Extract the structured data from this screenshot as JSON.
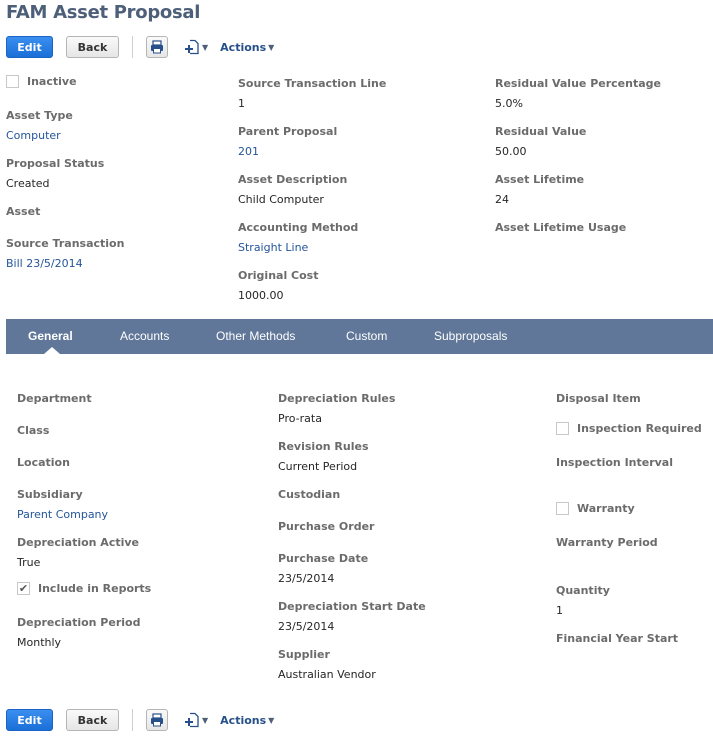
{
  "title": "FAM Asset Proposal",
  "toolbar": {
    "edit_label": "Edit",
    "back_label": "Back",
    "print_icon": "printer-icon",
    "new_icon": "new-record-icon",
    "actions_label": "Actions"
  },
  "header_fields": {
    "inactive": {
      "label": "Inactive",
      "checked": false
    },
    "asset_type": {
      "label": "Asset Type",
      "value": "Computer"
    },
    "proposal_status": {
      "label": "Proposal Status",
      "value": "Created"
    },
    "asset": {
      "label": "Asset",
      "value": ""
    },
    "source_transaction": {
      "label": "Source Transaction",
      "value": "Bill 23/5/2014"
    },
    "source_transaction_line": {
      "label": "Source Transaction Line",
      "value": "1"
    },
    "parent_proposal": {
      "label": "Parent Proposal",
      "value": "201"
    },
    "asset_description": {
      "label": "Asset Description",
      "value": "Child Computer"
    },
    "accounting_method": {
      "label": "Accounting Method",
      "value": "Straight Line"
    },
    "original_cost": {
      "label": "Original Cost",
      "value": "1000.00"
    },
    "residual_value_percentage": {
      "label": "Residual Value Percentage",
      "value": "5.0%"
    },
    "residual_value": {
      "label": "Residual Value",
      "value": "50.00"
    },
    "asset_lifetime": {
      "label": "Asset Lifetime",
      "value": "24"
    },
    "asset_lifetime_usage": {
      "label": "Asset Lifetime Usage",
      "value": ""
    }
  },
  "tabs": [
    {
      "label": "General",
      "active": true
    },
    {
      "label": "Accounts",
      "active": false
    },
    {
      "label": "Other Methods",
      "active": false
    },
    {
      "label": "Custom",
      "active": false
    },
    {
      "label": "Subproposals",
      "active": false
    }
  ],
  "general": {
    "department": {
      "label": "Department",
      "value": ""
    },
    "class": {
      "label": "Class",
      "value": ""
    },
    "location": {
      "label": "Location",
      "value": ""
    },
    "subsidiary": {
      "label": "Subsidiary",
      "value": "Parent Company"
    },
    "depreciation_active": {
      "label": "Depreciation Active",
      "value": "True"
    },
    "include_in_reports": {
      "label": "Include in Reports",
      "checked": true
    },
    "depreciation_period": {
      "label": "Depreciation Period",
      "value": "Monthly"
    },
    "depreciation_rules": {
      "label": "Depreciation Rules",
      "value": "Pro-rata"
    },
    "revision_rules": {
      "label": "Revision Rules",
      "value": "Current Period"
    },
    "custodian": {
      "label": "Custodian",
      "value": ""
    },
    "purchase_order": {
      "label": "Purchase Order",
      "value": ""
    },
    "purchase_date": {
      "label": "Purchase Date",
      "value": "23/5/2014"
    },
    "depreciation_start_date": {
      "label": "Depreciation Start Date",
      "value": "23/5/2014"
    },
    "supplier": {
      "label": "Supplier",
      "value": "Australian Vendor"
    },
    "disposal_item": {
      "label": "Disposal Item",
      "value": ""
    },
    "inspection_required": {
      "label": "Inspection Required",
      "checked": false
    },
    "inspection_interval": {
      "label": "Inspection Interval",
      "value": ""
    },
    "warranty": {
      "label": "Warranty",
      "checked": false
    },
    "warranty_period": {
      "label": "Warranty Period",
      "value": ""
    },
    "quantity": {
      "label": "Quantity",
      "value": "1"
    },
    "financial_year_start": {
      "label": "Financial Year Start",
      "value": ""
    }
  }
}
